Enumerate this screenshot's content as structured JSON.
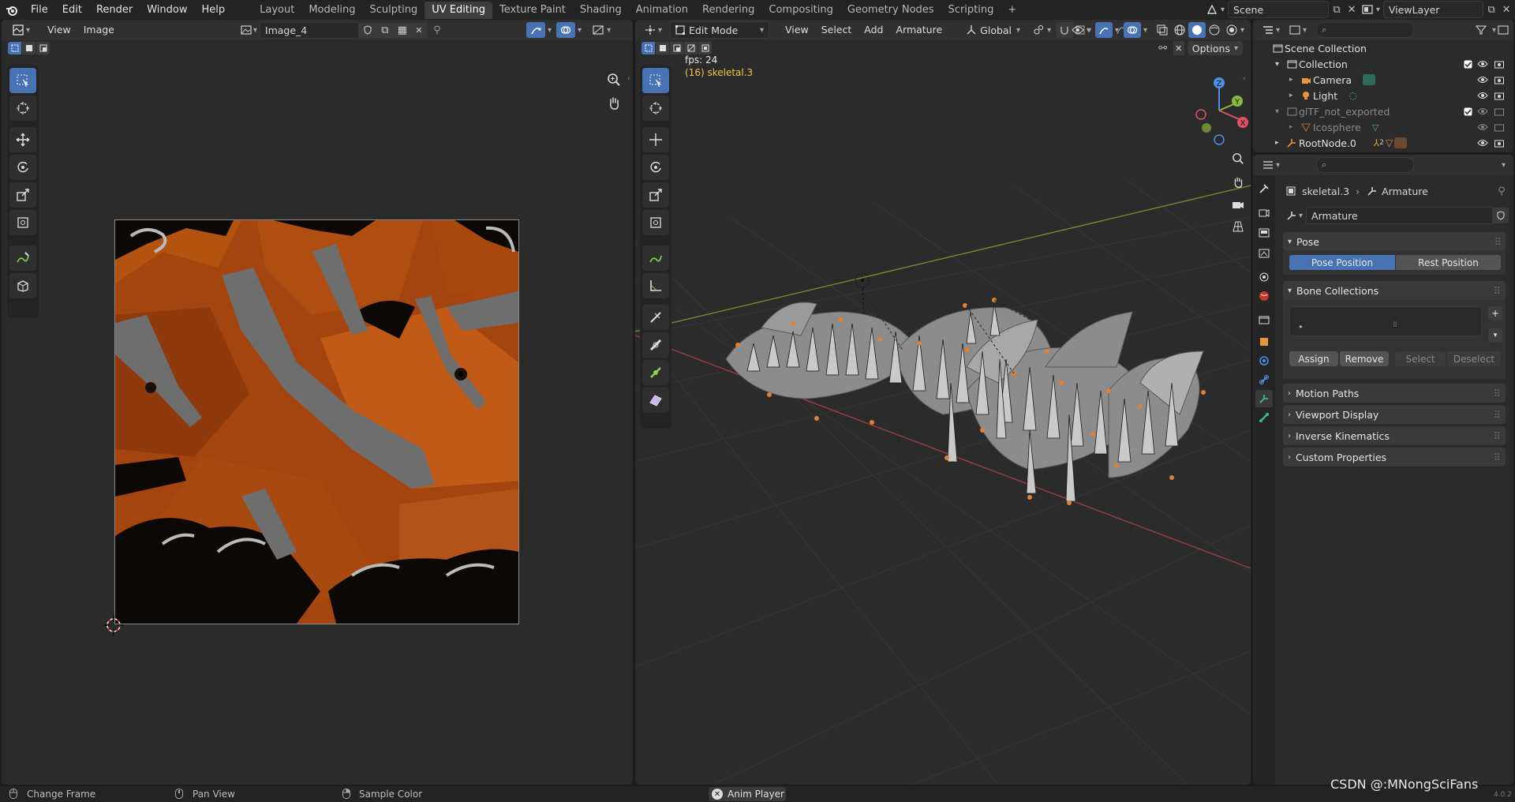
{
  "topbar": {
    "menus": [
      "File",
      "Edit",
      "Render",
      "Window",
      "Help"
    ],
    "workspaces": [
      "Layout",
      "Modeling",
      "Sculpting",
      "UV Editing",
      "Texture Paint",
      "Shading",
      "Animation",
      "Rendering",
      "Compositing",
      "Geometry Nodes",
      "Scripting"
    ],
    "active_workspace": "UV Editing",
    "add_tab": "+",
    "scene_name": "Scene",
    "view_layer_name": "ViewLayer"
  },
  "uv_editor": {
    "menus": [
      "View",
      "Image"
    ],
    "image_name": "Image_4"
  },
  "viewport": {
    "mode": "Edit Mode",
    "menus": [
      "View",
      "Select",
      "Add",
      "Armature"
    ],
    "transform_orientation": "Global",
    "options_label": "Options",
    "fps_text": "fps: 24",
    "object_text": "(16) skeletal.3",
    "gizmo": {
      "z": "Z",
      "y": "Y",
      "x": "X"
    }
  },
  "outliner": {
    "items": [
      {
        "label": "Scene Collection"
      },
      {
        "label": "Collection"
      },
      {
        "label": "Camera"
      },
      {
        "label": "Light"
      },
      {
        "label": "glTF_not_exported"
      },
      {
        "label": "Icosphere"
      },
      {
        "label": "RootNode.0"
      }
    ],
    "rootnode_count": "2"
  },
  "properties": {
    "breadcrumb_object": "skeletal.3",
    "breadcrumb_data": "Armature",
    "data_name": "Armature",
    "pose_panel": "Pose",
    "pose_position": "Pose Position",
    "rest_position": "Rest Position",
    "bone_collections_panel": "Bone Collections",
    "assign": "Assign",
    "remove": "Remove",
    "select": "Select",
    "deselect": "Deselect",
    "plus": "+",
    "motion_paths": "Motion Paths",
    "viewport_display": "Viewport Display",
    "inverse_kinematics": "Inverse Kinematics",
    "custom_properties": "Custom Properties"
  },
  "status": {
    "change_frame": "Change Frame",
    "pan_view": "Pan View",
    "sample_color": "Sample Color",
    "anim_player": "Anim Player",
    "watermark": "CSDN @:MNongSciFans",
    "version": "4.0.2"
  },
  "colors": {
    "accent": "#4772b3",
    "clownfish_orange": "#a8470f",
    "x_axis": "#e05263",
    "y_axis": "#8bb93b",
    "z_axis": "#4d8ee6"
  }
}
